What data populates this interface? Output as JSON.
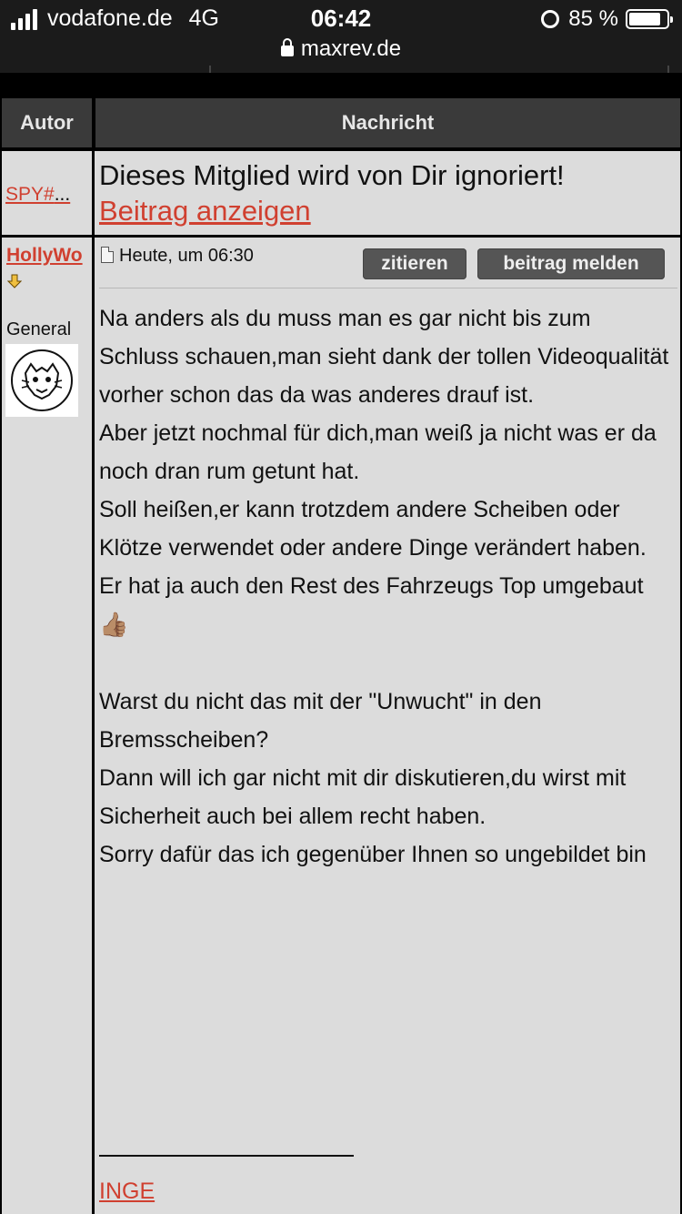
{
  "status_bar": {
    "carrier": "vodafone.de",
    "network": "4G",
    "time": "06:42",
    "battery": "85 %",
    "battery_level": 0.85,
    "url": "maxrev.de"
  },
  "table": {
    "headers": {
      "author": "Autor",
      "message": "Nachricht"
    }
  },
  "ignored_post": {
    "author": "SPY#",
    "author_ellipsis": "...",
    "notice": "Dieses Mitglied wird von Dir ignoriert!",
    "show_link": "Beitrag anzeigen"
  },
  "post": {
    "author": "HollyWo",
    "rank": "General",
    "date": "Heute, um 06:30",
    "quote_button": "zitieren",
    "report_button": "beitrag melden",
    "body": [
      "Na anders als du muss man es gar nicht bis zum Schluss schauen,man sieht dank der tollen Videoqualität vorher schon das da was anderes drauf ist.",
      "Aber jetzt nochmal für dich,man weiß ja nicht was er da noch dran rum getunt hat.",
      "Soll heißen,er kann trotzdem andere Scheiben oder Klötze verwendet oder andere Dinge verändert haben.",
      "Er hat ja auch den Rest des Fahrzeugs Top umgebaut",
      "Warst du nicht das mit der \"Unwucht\" in den Bremsscheiben?",
      "Dann will ich gar nicht mit dir diskutieren,du wirst mit Sicherheit auch bei allem recht haben.",
      "Sorry dafür das ich gegenüber Ihnen so ungebildet bin"
    ],
    "emoji": "👍🏽",
    "signature": "INGE"
  },
  "colors": {
    "link": "#d04030",
    "header_bg": "#3a3a3a",
    "cell_bg": "#dcdcdc",
    "button_bg": "#555555"
  }
}
